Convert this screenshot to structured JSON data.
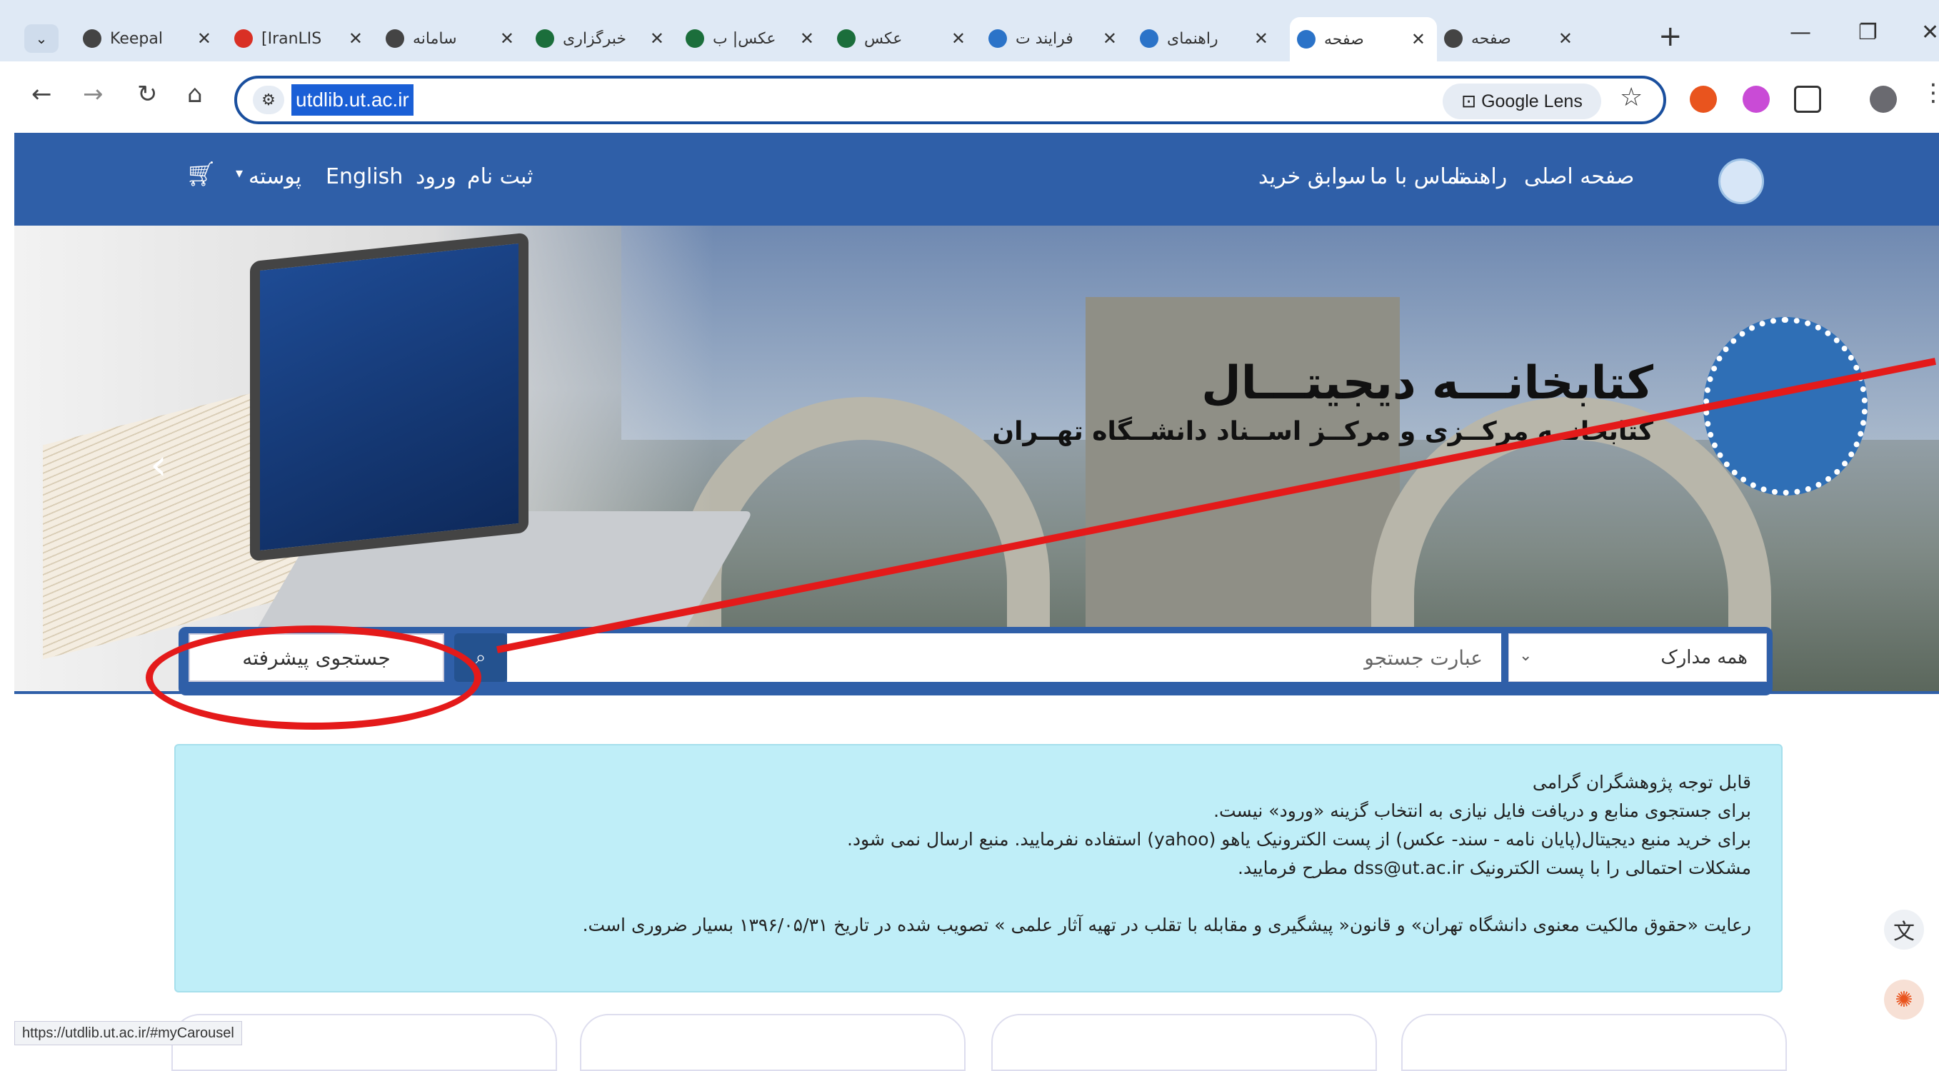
{
  "browser": {
    "tabs": [
      {
        "label": "Keepal",
        "close": "✕",
        "favicon": "globe-icon",
        "color": "#444"
      },
      {
        "label": "[IranLIS",
        "close": "✕",
        "favicon": "gmail-icon",
        "color": "#d93025"
      },
      {
        "label": "سامانه",
        "close": "✕",
        "favicon": "globe-icon",
        "color": "#444"
      },
      {
        "label": "خبرگزاری",
        "close": "✕",
        "favicon": "news-icon",
        "color": "#1b6e3b"
      },
      {
        "label": "عکس| ب",
        "close": "✕",
        "favicon": "news-icon",
        "color": "#1b6e3b"
      },
      {
        "label": "عکس",
        "close": "✕",
        "favicon": "news-icon",
        "color": "#1b6e3b"
      },
      {
        "label": "فرایند ت",
        "close": "✕",
        "favicon": "ut-icon",
        "color": "#2b73c8"
      },
      {
        "label": "راهنمای",
        "close": "✕",
        "favicon": "ut-icon",
        "color": "#2b73c8"
      },
      {
        "label": "صفحه",
        "close": "✕",
        "favicon": "ut-icon",
        "color": "#2b73c8"
      },
      {
        "label": "صفحه",
        "close": "✕",
        "favicon": "globe-icon",
        "color": "#444"
      }
    ],
    "new_tab": "+",
    "address": "utdlib.ut.ac.ir",
    "lens_label": "Google Lens",
    "status_url": "https://utdlib.ut.ac.ir/#myCarousel"
  },
  "header": {
    "nav": [
      "صفحه اصلی",
      "راهنما",
      "تماس با ما",
      "سوابق خرید"
    ],
    "right_links": [
      "ثبت نام",
      "ورود",
      "English",
      "پوسته"
    ]
  },
  "banner": {
    "title": "کتابخانـــه دیجیتـــال",
    "subtitle": "کتابخانــه مرکــزی و مرکــز اســناد دانشــگاه تهــران"
  },
  "search": {
    "advanced_label": "جستجوی پیشرفته",
    "placeholder": "عبارت جستجو",
    "category": "همه مدارک"
  },
  "notice": {
    "lines": [
      "قابل توجه پژوهشگران گرامی",
      "برای جستجوی منابع و دریافت فایل نیازی به انتخاب گزینه «ورود» نیست.",
      "برای خرید منبع دیجیتال(پایان نامه - سند- عکس) از پست الکترونیک یاهو (yahoo) استفاده نفرمایید. منبع ارسال نمی شود.",
      "مشکلات احتمالی را با پست الکترونیک dss@ut.ac.ir مطرح فرمایید."
    ],
    "footer": "رعایت «حقوق مالکیت معنوی دانشگاه تهران» و قانون« پیشگیری و مقابله با تقلب در تهیه آثار علمی » تصویب شده در تاریخ ۱۳۹۶/۰۵/۳۱ بسیار ضروری است."
  },
  "colors": {
    "accent": "#2f5fa8",
    "highlight": "#e41a1a",
    "notice_bg": "#bfeef8"
  }
}
